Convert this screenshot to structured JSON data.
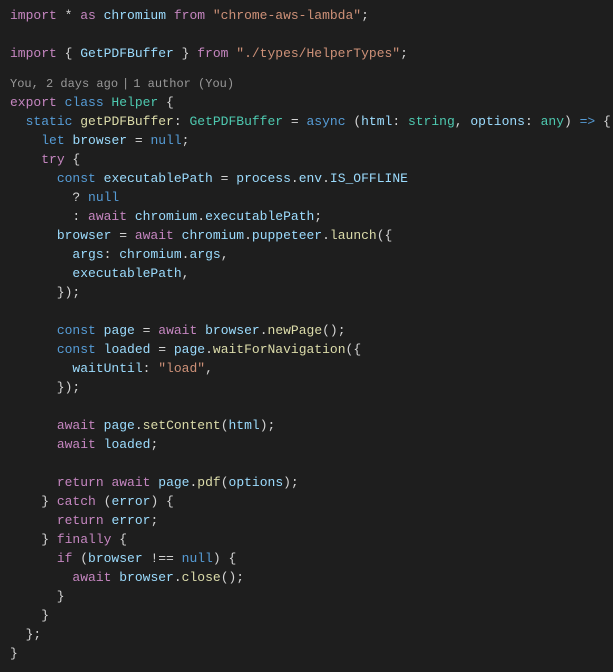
{
  "codelens": {
    "author": "You, 2 days ago",
    "sep": "|",
    "authors": "1 author (You)"
  },
  "lines": {
    "l1a": "import",
    "l1b": " * ",
    "l1c": "as",
    "l1d": " chromium ",
    "l1e": "from",
    "l1f": " \"chrome-aws-lambda\"",
    "l1g": ";",
    "l2": "",
    "l3a": "import",
    "l3b": " { ",
    "l3c": "GetPDFBuffer",
    "l3d": " } ",
    "l3e": "from",
    "l3f": " \"./types/HelperTypes\"",
    "l3g": ";",
    "l4a": "export",
    "l4b": " class ",
    "l4c": "Helper",
    "l4d": " {",
    "l5a": "  ",
    "l5b": "static",
    "l5c": " ",
    "l5d": "getPDFBuffer",
    "l5e": ": ",
    "l5f": "GetPDFBuffer",
    "l5g": " = ",
    "l5h": "async",
    "l5i": " (",
    "l5j": "html",
    "l5k": ": ",
    "l5l": "string",
    "l5m": ", ",
    "l5n": "options",
    "l5o": ": ",
    "l5p": "any",
    "l5q": ") ",
    "l5r": "=>",
    "l5s": " {",
    "l6a": "    ",
    "l6b": "let",
    "l6c": " ",
    "l6d": "browser",
    "l6e": " = ",
    "l6f": "null",
    "l6g": ";",
    "l7a": "    ",
    "l7b": "try",
    "l7c": " {",
    "l8a": "      ",
    "l8b": "const",
    "l8c": " ",
    "l8d": "executablePath",
    "l8e": " = ",
    "l8f": "process",
    "l8g": ".",
    "l8h": "env",
    "l8i": ".",
    "l8j": "IS_OFFLINE",
    "l9a": "        ? ",
    "l9b": "null",
    "l10a": "        : ",
    "l10b": "await",
    "l10c": " ",
    "l10d": "chromium",
    "l10e": ".",
    "l10f": "executablePath",
    "l10g": ";",
    "l11a": "      ",
    "l11b": "browser",
    "l11c": " = ",
    "l11d": "await",
    "l11e": " ",
    "l11f": "chromium",
    "l11g": ".",
    "l11h": "puppeteer",
    "l11i": ".",
    "l11j": "launch",
    "l11k": "({",
    "l12a": "        ",
    "l12b": "args",
    "l12c": ": ",
    "l12d": "chromium",
    "l12e": ".",
    "l12f": "args",
    "l12g": ",",
    "l13a": "        ",
    "l13b": "executablePath",
    "l13c": ",",
    "l14a": "      });",
    "l15": "",
    "l16a": "      ",
    "l16b": "const",
    "l16c": " ",
    "l16d": "page",
    "l16e": " = ",
    "l16f": "await",
    "l16g": " ",
    "l16h": "browser",
    "l16i": ".",
    "l16j": "newPage",
    "l16k": "();",
    "l17a": "      ",
    "l17b": "const",
    "l17c": " ",
    "l17d": "loaded",
    "l17e": " = ",
    "l17f": "page",
    "l17g": ".",
    "l17h": "waitForNavigation",
    "l17i": "({",
    "l18a": "        ",
    "l18b": "waitUntil",
    "l18c": ": ",
    "l18d": "\"load\"",
    "l18e": ",",
    "l19a": "      });",
    "l20": "",
    "l21a": "      ",
    "l21b": "await",
    "l21c": " ",
    "l21d": "page",
    "l21e": ".",
    "l21f": "setContent",
    "l21g": "(",
    "l21h": "html",
    "l21i": ");",
    "l22a": "      ",
    "l22b": "await",
    "l22c": " ",
    "l22d": "loaded",
    "l22e": ";",
    "l23": "",
    "l24a": "      ",
    "l24b": "return",
    "l24c": " ",
    "l24d": "await",
    "l24e": " ",
    "l24f": "page",
    "l24g": ".",
    "l24h": "pdf",
    "l24i": "(",
    "l24j": "options",
    "l24k": ");",
    "l25a": "    } ",
    "l25b": "catch",
    "l25c": " (",
    "l25d": "error",
    "l25e": ") {",
    "l26a": "      ",
    "l26b": "return",
    "l26c": " ",
    "l26d": "error",
    "l26e": ";",
    "l27a": "    } ",
    "l27b": "finally",
    "l27c": " {",
    "l28a": "      ",
    "l28b": "if",
    "l28c": " (",
    "l28d": "browser",
    "l28e": " !== ",
    "l28f": "null",
    "l28g": ") {",
    "l29a": "        ",
    "l29b": "await",
    "l29c": " ",
    "l29d": "browser",
    "l29e": ".",
    "l29f": "close",
    "l29g": "();",
    "l30a": "      }",
    "l31a": "    }",
    "l32a": "  };",
    "l33a": "}"
  }
}
